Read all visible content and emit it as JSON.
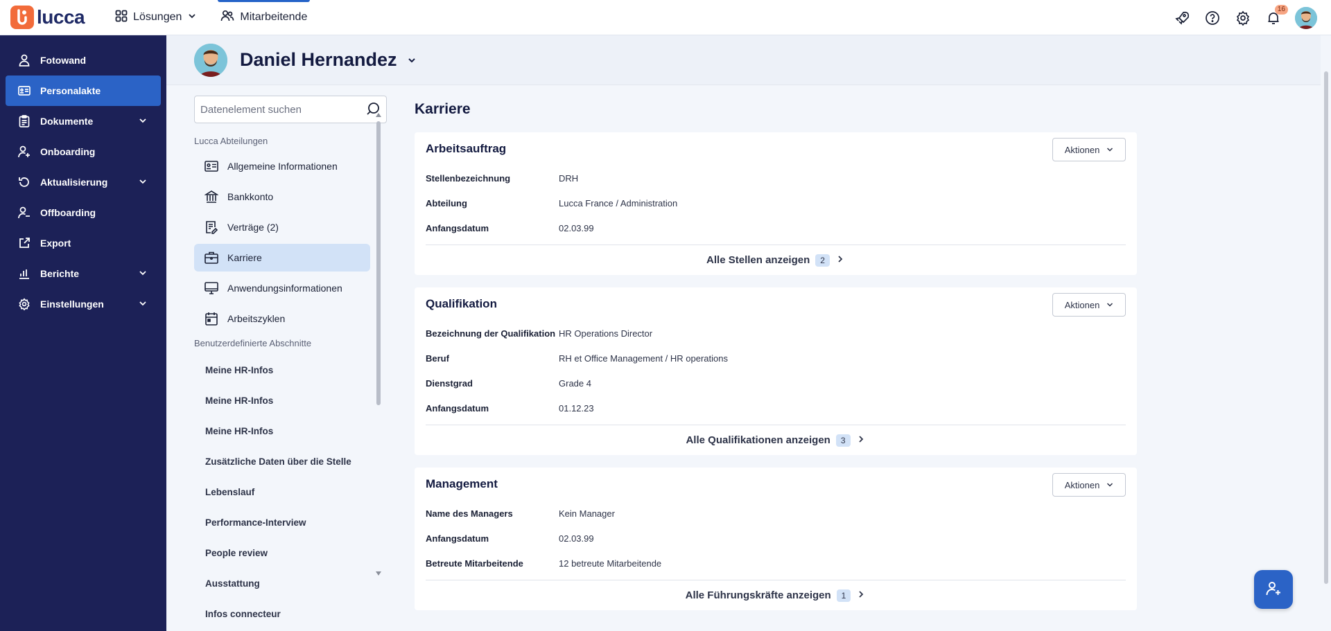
{
  "app": {
    "logo_text": "lucca"
  },
  "topnav": {
    "solutions_label": "Lösungen",
    "employees_label": "Mitarbeitende",
    "notification_count": "16"
  },
  "sidebar": {
    "items": [
      {
        "label": "Fotowand"
      },
      {
        "label": "Personalakte"
      },
      {
        "label": "Dokumente"
      },
      {
        "label": "Onboarding"
      },
      {
        "label": "Aktualisierung"
      },
      {
        "label": "Offboarding"
      },
      {
        "label": "Export"
      },
      {
        "label": "Berichte"
      },
      {
        "label": "Einstellungen"
      }
    ]
  },
  "profile": {
    "name": "Daniel Hernandez"
  },
  "sections_nav": {
    "search_placeholder": "Datenelement suchen",
    "group1": "Lucca Abteilungen",
    "group1_items": [
      "Allgemeine Informationen",
      "Bankkonto",
      "Verträge (2)",
      "Karriere",
      "Anwendungsinformationen",
      "Arbeitszyklen"
    ],
    "group2": "Benutzerdefinierte Abschnitte",
    "group2_items": [
      "Meine HR-Infos",
      "Meine HR-Infos",
      "Meine HR-Infos",
      "Zusätzliche Daten über die Stelle",
      "Lebenslauf",
      "Performance-Interview",
      "People review",
      "Ausstattung",
      "Infos connecteur"
    ]
  },
  "content": {
    "title": "Karriere",
    "actions_label": "Aktionen",
    "cards": [
      {
        "title": "Arbeitsauftrag",
        "rows": [
          {
            "label": "Stellenbezeichnung",
            "value": "DRH"
          },
          {
            "label": "Abteilung",
            "value": "Lucca France / Administration"
          },
          {
            "label": "Anfangsdatum",
            "value": "02.03.99"
          }
        ],
        "footer": "Alle Stellen anzeigen",
        "count": "2"
      },
      {
        "title": "Qualifikation",
        "rows": [
          {
            "label": "Bezeichnung der Qualifikation",
            "value": "HR Operations Director"
          },
          {
            "label": "Beruf",
            "value": "RH et Office Management / HR operations"
          },
          {
            "label": "Dienstgrad",
            "value": "Grade 4"
          },
          {
            "label": "Anfangsdatum",
            "value": "01.12.23"
          }
        ],
        "footer": "Alle Qualifikationen anzeigen",
        "count": "3"
      },
      {
        "title": "Management",
        "rows": [
          {
            "label": "Name des Managers",
            "value": "Kein Manager"
          },
          {
            "label": "Anfangsdatum",
            "value": "02.03.99"
          },
          {
            "label": "Betreute Mitarbeitende",
            "value": "12 betreute Mitarbeitende"
          }
        ],
        "footer": "Alle Führungskräfte anzeigen",
        "count": "1"
      }
    ]
  }
}
